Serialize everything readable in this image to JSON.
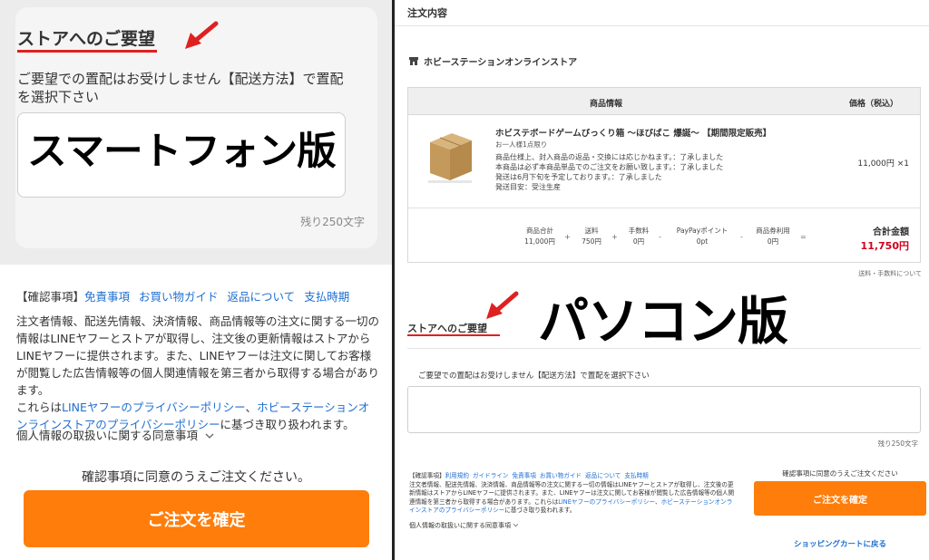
{
  "smartphone": {
    "title": "ストアへのご要望",
    "description": "ご要望での置配はお受けしません【配送方法】で置配を選択下さい",
    "overlay_label": "スマートフォン版",
    "remaining": "残り250文字",
    "confirm_heading": "【確認事項】",
    "links": [
      "免責事項",
      "お買い物ガイド",
      "返品について",
      "支払時期"
    ],
    "confirm_text": "注文者情報、配送先情報、決済情報、商品情報等の注文に関する一切の情報はLINEヤフーとストアが取得し、注文後の更新情報はストアからLINEヤフーに提供されます。また、LINEヤフーは注文に関してお客様が閲覧した広告情報等の個人関連情報を第三者から取得する場合があります。",
    "privacy_prefix": "これらは",
    "privacy_link1": "LINEヤフーのプライバシーポリシー",
    "privacy_sep": "、",
    "privacy_link2": "ホビーステーションオンラインストアのプライバシーポリシー",
    "privacy_suffix": "に基づき取り扱われます。",
    "consent_toggle": "個人情報の取扱いに関する同意事項",
    "agree_text": "確認事項に同意のうえご注文ください。",
    "order_button": "ご注文を確定"
  },
  "pc": {
    "order_title": "注文内容",
    "store_name": "ホビーステーションオンラインストア",
    "table_header_info": "商品情報",
    "table_header_price": "価格（税込）",
    "item_name": "ホビステボードゲームびっくり箱 〜ほびばこ 爆誕〜 【期間限定販売】",
    "item_limit": "お一人様1点限り",
    "item_notes": [
      "商品仕様上、封入商品の返品・交換には応じかねます。：了承しました",
      "本商品は必ず本商品単品でのご注文をお願い致します。：了承しました",
      "発送は6月下旬を予定しております。：了承しました",
      "発送目安：受注生産"
    ],
    "item_price": "11,000円 ×1",
    "summary": [
      {
        "label": "商品合計",
        "value": "11,000円"
      },
      {
        "label": "送料",
        "value": "750円"
      },
      {
        "label": "手数料",
        "value": "0円"
      },
      {
        "label": "PayPayポイント",
        "value": "0pt"
      },
      {
        "label": "商品券利用",
        "value": "0円"
      }
    ],
    "summary_ops": [
      "+",
      "+",
      "-",
      "-",
      "="
    ],
    "total_label": "合計金額",
    "total_value": "11,750円",
    "fee_note": "送料・手数料について",
    "request_title": "ストアへのご要望",
    "big_label": "パソコン版",
    "request_desc": "ご要望での置配はお受けしません【配送方法】で置配を選択下さい",
    "remaining": "残り250文字",
    "confirm_heading": "【確認事項】",
    "links": [
      "利用規約",
      "ガイドライン",
      "免責事項",
      "お買い物ガイド",
      "返品について",
      "支払時期"
    ],
    "confirm_text": "注文者情報、配送先情報、決済情報、商品情報等の注文に関する一切の情報はLINEヤフーとストアが取得し、注文後の更新情報はストアからLINEヤフーに提供されます。また、LINEヤフーは注文に関してお客様が閲覧した広告情報等の個人関連情報を第三者から取得する場合があります。これらは",
    "privacy_link1": "LINEヤフーのプライバシーポリシー",
    "privacy_sep": "、",
    "privacy_link2": "ホビーステーションオンラインストアのプライバシーポリシー",
    "privacy_suffix": "に基づき取り扱われます。",
    "consent_toggle": "個人情報の取扱いに関する同意事項",
    "agree_text": "確認事項に同意のうえご注文ください",
    "order_button": "ご注文を確定",
    "cart_link": "ショッピングカートに戻る"
  },
  "colors": {
    "accent_orange": "#ff7d0a",
    "annotation_red": "#e02020",
    "link_blue": "#1f6fd0",
    "total_red": "#d0021b"
  },
  "icons": {
    "arrow": "red-arrow-icon",
    "store": "store-icon",
    "chevron": "chevron-down-icon"
  }
}
